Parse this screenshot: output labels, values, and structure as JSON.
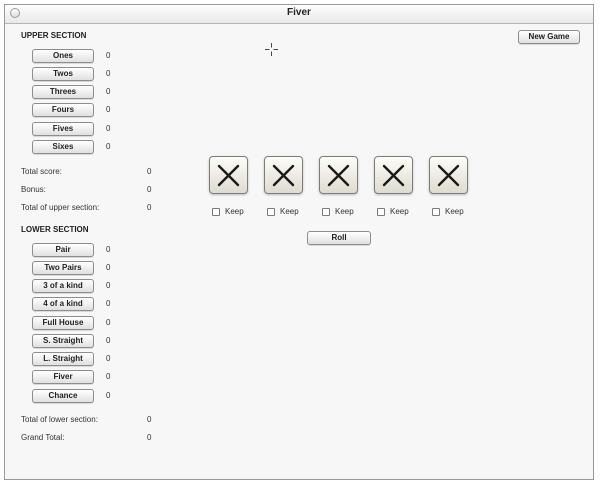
{
  "window": {
    "title": "Fiver"
  },
  "upper_section": {
    "heading": "UPPER SECTION",
    "categories": [
      {
        "label": "Ones",
        "score": "0"
      },
      {
        "label": "Twos",
        "score": "0"
      },
      {
        "label": "Threes",
        "score": "0"
      },
      {
        "label": "Fours",
        "score": "0"
      },
      {
        "label": "Fives",
        "score": "0"
      },
      {
        "label": "Sixes",
        "score": "0"
      }
    ],
    "totals": [
      {
        "label": "Total score:",
        "value": "0"
      },
      {
        "label": "Bonus:",
        "value": "0"
      },
      {
        "label": "Total of upper section:",
        "value": "0"
      }
    ]
  },
  "lower_section": {
    "heading": "LOWER SECTION",
    "categories": [
      {
        "label": "Pair",
        "score": "0"
      },
      {
        "label": "Two Pairs",
        "score": "0"
      },
      {
        "label": "3 of a kind",
        "score": "0"
      },
      {
        "label": "4 of a kind",
        "score": "0"
      },
      {
        "label": "Full House",
        "score": "0"
      },
      {
        "label": "S. Straight",
        "score": "0"
      },
      {
        "label": "L. Straight",
        "score": "0"
      },
      {
        "label": "Fiver",
        "score": "0"
      },
      {
        "label": "Chance",
        "score": "0"
      }
    ],
    "totals": [
      {
        "label": "Total of lower section:",
        "value": "0"
      },
      {
        "label": "Grand Total:",
        "value": "0"
      }
    ]
  },
  "dice": [
    {
      "icon": "x-mark-icon",
      "keep_label": "Keep",
      "kept": false
    },
    {
      "icon": "x-mark-icon",
      "keep_label": "Keep",
      "kept": false
    },
    {
      "icon": "x-mark-icon",
      "keep_label": "Keep",
      "kept": false
    },
    {
      "icon": "x-mark-icon",
      "keep_label": "Keep",
      "kept": false
    },
    {
      "icon": "x-mark-icon",
      "keep_label": "Keep",
      "kept": false
    }
  ],
  "controls": {
    "roll_label": "Roll",
    "new_game_label": "New Game"
  }
}
